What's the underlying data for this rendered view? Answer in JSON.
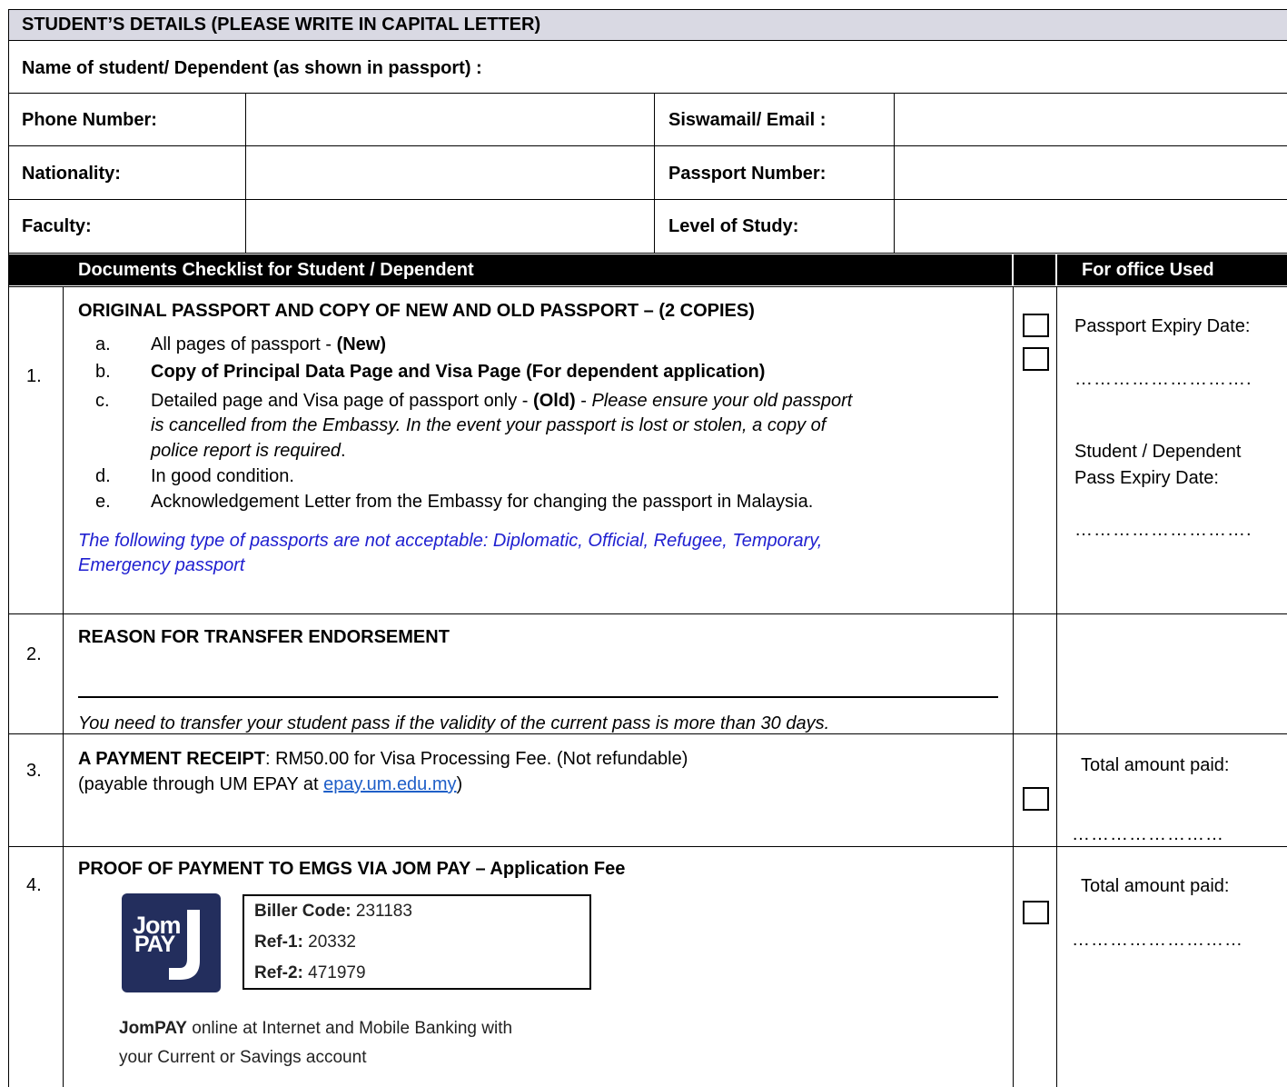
{
  "header": {
    "title": "STUDENT’S DETAILS (PLEASE WRITE IN CAPITAL LETTER)"
  },
  "student": {
    "name_label": "Name of student/ Dependent (as shown in passport) :",
    "phone_label": "Phone Number:",
    "email_label": "Siswamail/ Email :",
    "nationality_label": "Nationality:",
    "passport_label": "Passport Number:",
    "faculty_label": "Faculty:",
    "level_label": "Level of Study:"
  },
  "checklist": {
    "header": "Documents Checklist for Student / Dependent",
    "office_header": "For office Used",
    "item1": {
      "num": "1.",
      "title": "ORIGINAL PASSPORT AND COPY OF NEW AND OLD PASSPORT – (2 COPIES)",
      "a_letter": "a.",
      "a_text": "All pages of passport - ",
      "a_bold": "(New)",
      "b_letter": "b.",
      "b_text": "Copy of Principal Data Page and Visa Page (For dependent application)",
      "c_letter": "c.",
      "c_text": "Detailed page and Visa page of passport only - ",
      "c_bold": "(Old)",
      "c_dash": " - ",
      "c_italic1": "Please ensure your old passport",
      "c_italic2": "is cancelled from the Embassy. In the event your passport is lost or stolen, a copy of",
      "c_italic3": "police report is required",
      "c_period": ".",
      "d_letter": "d.",
      "d_text": "In good condition.",
      "e_letter": "e.",
      "e_text": "Acknowledgement Letter from the Embassy for changing the passport in Malaysia.",
      "note1": "The following type of passports are not acceptable: Diplomatic, Official, Refugee, Temporary,",
      "note2": "Emergency passport",
      "office1": "Passport Expiry Date:",
      "dots1": "……………………….",
      "office2a": "Student / Dependent",
      "office2b": "Pass Expiry Date:",
      "dots2": "……………………….",
      "color_note": "#1f1fd0"
    },
    "item2": {
      "num": "2.",
      "title": "REASON FOR TRANSFER ENDORSEMENT",
      "note": "You need to transfer your student pass if the validity of the current pass is more than 30 days."
    },
    "item3": {
      "num": "3.",
      "title_bold": "A PAYMENT RECEIPT",
      "title_rest": ": RM50.00 for Visa Processing Fee. (Not refundable)",
      "line2": " (payable through UM EPAY at ",
      "link": "epay.um.edu.my",
      "line2_end": ")",
      "office": "Total amount paid:",
      "dots": "……………………"
    },
    "item4": {
      "num": "4.",
      "title": "PROOF OF PAYMENT TO EMGS VIA JOM PAY – Application Fee",
      "logo_top": "Jom",
      "logo_bottom": "PAY",
      "biller_label": "Biller Code:",
      "biller_value": " 231183",
      "ref1_label": "Ref-1:",
      "ref1_value": " 20332",
      "ref2_label": "Ref-2:",
      "ref2_value": " 471979",
      "jompay_bold": "JomPAY",
      "jompay_rest": " online at Internet and Mobile Banking with",
      "jompay_line2": "your Current or Savings account",
      "office": "Total amount paid:",
      "dots": "………………………",
      "brand_color": "#232e5d"
    }
  }
}
